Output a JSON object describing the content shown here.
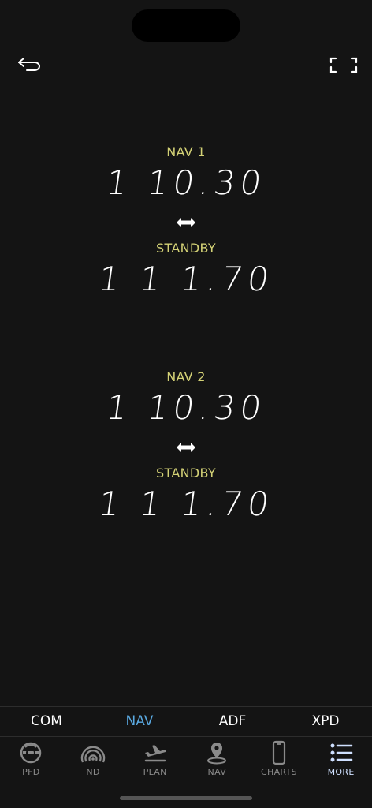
{
  "radios": [
    {
      "label": "NAV 1",
      "active": "1 10.30",
      "standby_label": "STANDBY",
      "standby": "1 1 1.70"
    },
    {
      "label": "NAV 2",
      "active": "1 10.30",
      "standby_label": "STANDBY",
      "standby": "1 1 1.70"
    }
  ],
  "radio_tabs": [
    {
      "label": "COM",
      "active": false
    },
    {
      "label": "NAV",
      "active": true
    },
    {
      "label": "ADF",
      "active": false
    },
    {
      "label": "XPD",
      "active": false
    }
  ],
  "bottom_nav": [
    {
      "label": "PFD",
      "icon": "attitude-indicator-icon",
      "active": false
    },
    {
      "label": "ND",
      "icon": "radar-icon",
      "active": false
    },
    {
      "label": "PLAN",
      "icon": "plane-departure-icon",
      "active": false
    },
    {
      "label": "NAV",
      "icon": "map-pin-icon",
      "active": false
    },
    {
      "label": "CHARTS",
      "icon": "phone-chart-icon",
      "active": false
    },
    {
      "label": "MORE",
      "icon": "list-icon",
      "active": true
    }
  ],
  "colors": {
    "background": "#141414",
    "label_yellow": "#d4d276",
    "active_tab_blue": "#59a8e0",
    "active_nav": "#cfe0ff",
    "inactive_nav": "#8a8a8a"
  }
}
